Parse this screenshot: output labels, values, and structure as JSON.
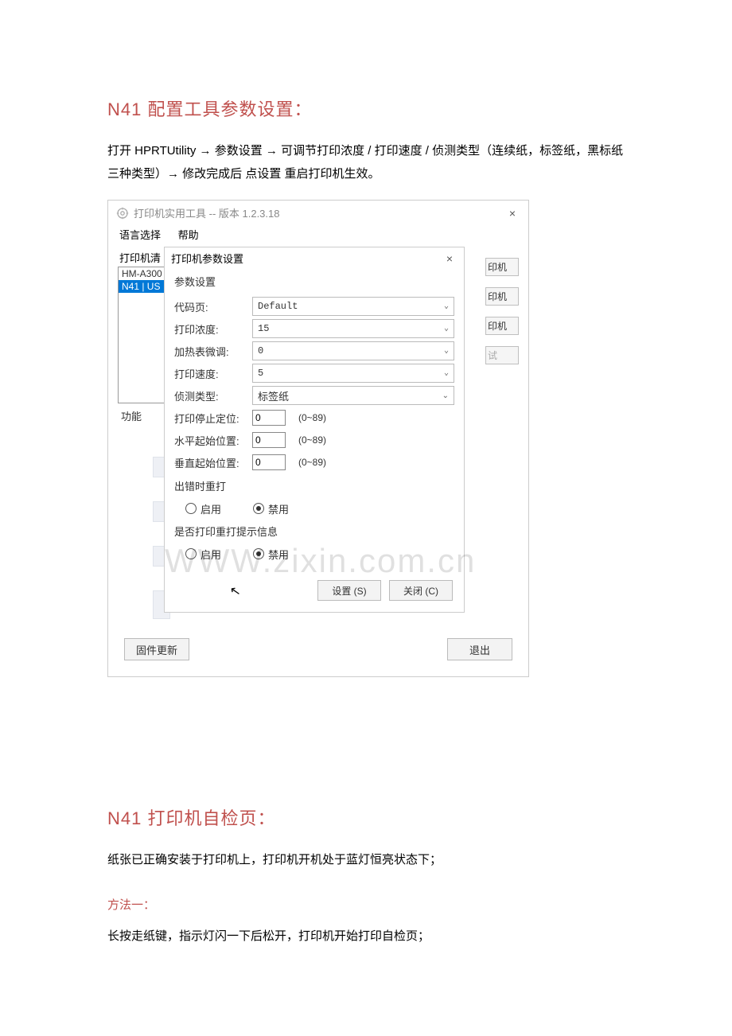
{
  "doc": {
    "heading1": "N41 配置工具参数设置：",
    "intro": "打开 HPRTUtility  →  参数设置 →  可调节打印浓度 / 打印速度 / 侦测类型（连续纸，标签纸，黑标纸三种类型）→  修改完成后 点设置 重启打印机生效。",
    "heading2": "N41 打印机自检页：",
    "body2": "纸张已正确安装于打印机上，打印机开机处于蓝灯恒亮状态下；",
    "method_label": "方法一：",
    "method_text": "长按走纸键，指示灯闪一下后松开，打印机开始打印自检页；",
    "watermark": "WWW.zixin.com.cn"
  },
  "win": {
    "title": "打印机实用工具 -- 版本 1.2.3.18",
    "menu": {
      "lang": "语言选择",
      "help": "帮助"
    },
    "list_caption": "打印机清",
    "printers": {
      "a": "HM-A300",
      "b": "N41 | US"
    },
    "func_label": "功能",
    "right_btn_text": "印机",
    "right_btn_gray": "试",
    "footer_update": "固件更新",
    "footer_exit": "退出"
  },
  "dlg": {
    "title": "打印机参数设置",
    "section": "参数设置",
    "codepage_lbl": "代码页:",
    "codepage_val": "Default",
    "density_lbl": "打印浓度:",
    "density_val": "15",
    "heat_lbl": "加热表微调:",
    "heat_val": "0",
    "speed_lbl": "打印速度:",
    "speed_val": "5",
    "detect_lbl": "侦测类型:",
    "detect_val": "标签纸",
    "stop_lbl": "打印停止定位:",
    "stop_val": "0",
    "hstart_lbl": "水平起始位置:",
    "hstart_val": "0",
    "vstart_lbl": "垂直起始位置:",
    "vstart_val": "0",
    "range": "(0~89)",
    "reprint_lbl": "出错时重打",
    "prompt_lbl": "是否打印重打提示信息",
    "enable": "启用",
    "disable": "禁用",
    "btn_set": "设置 (S)",
    "btn_close": "关闭 (C)"
  }
}
